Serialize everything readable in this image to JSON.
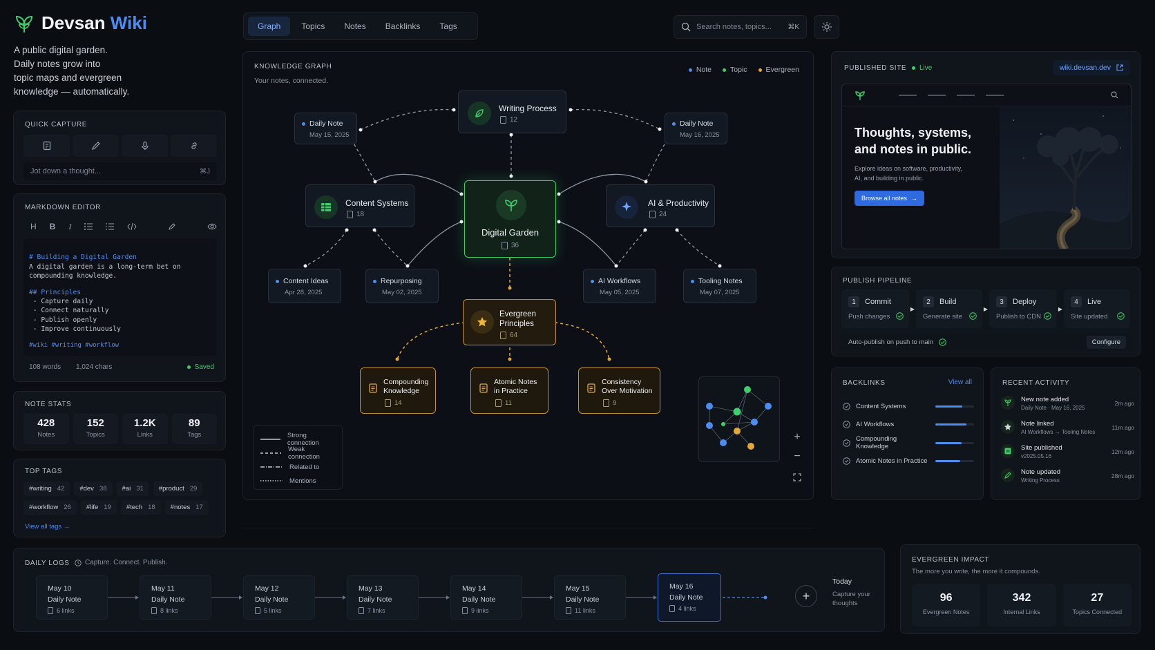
{
  "brand": {
    "name1": "Devsan",
    "name2": "Wiki",
    "tagline": [
      "A public digital garden.",
      "Daily notes grow into",
      "topic maps and evergreen",
      "knowledge — automatically."
    ]
  },
  "nav": {
    "tabs": [
      "Graph",
      "Topics",
      "Notes",
      "Backlinks",
      "Tags"
    ],
    "active": 0
  },
  "search": {
    "placeholder": "Search notes, topics...",
    "shortcut": "⌘K"
  },
  "quick_capture": {
    "title": "QUICK CAPTURE",
    "placeholder": "Jot down a thought...",
    "shortcut": "⌘J",
    "icons": [
      "note-icon",
      "pen-icon",
      "mic-icon",
      "link-icon"
    ]
  },
  "editor": {
    "title": "MARKDOWN EDITOR",
    "toolbar": [
      "H",
      "B",
      "I"
    ],
    "lines": [
      "# Building a Digital Garden",
      "A digital garden is a long-term bet on",
      "compounding knowledge.",
      "",
      "## Principles",
      " - Capture daily",
      " - Connect naturally",
      " - Publish openly",
      " - Improve continuously",
      "",
      "#wiki #writing #workflow"
    ],
    "words": "108 words",
    "chars": "1,024 chars",
    "status": "Saved"
  },
  "stats": {
    "title": "NOTE STATS",
    "items": [
      {
        "value": "428",
        "label": "Notes"
      },
      {
        "value": "152",
        "label": "Topics"
      },
      {
        "value": "1.2K",
        "label": "Links"
      },
      {
        "value": "89",
        "label": "Tags"
      }
    ]
  },
  "tags": {
    "title": "TOP TAGS",
    "items": [
      {
        "name": "#writing",
        "count": "42"
      },
      {
        "name": "#dev",
        "count": "38"
      },
      {
        "name": "#ai",
        "count": "31"
      },
      {
        "name": "#product",
        "count": "29"
      },
      {
        "name": "#workflow",
        "count": "26"
      },
      {
        "name": "#life",
        "count": "19"
      },
      {
        "name": "#tech",
        "count": "18"
      },
      {
        "name": "#notes",
        "count": "17"
      }
    ],
    "view_all": "View all tags"
  },
  "graph": {
    "title": "KNOWLEDGE GRAPH",
    "subtitle": "Your notes, connected.",
    "legend": [
      {
        "label": "Note",
        "color": "#4d8cf0"
      },
      {
        "label": "Topic",
        "color": "#3ecf6a"
      },
      {
        "label": "Evergreen",
        "color": "#e0a83a"
      }
    ],
    "center": {
      "title": "Digital Garden",
      "count": "36"
    },
    "writing": {
      "title": "Writing Process",
      "count": "12"
    },
    "content": {
      "title": "Content Systems",
      "count": "18"
    },
    "ai": {
      "title": "AI & Productivity",
      "count": "24"
    },
    "evergreen": {
      "title1": "Evergreen",
      "title2": "Principles",
      "count": "64"
    },
    "daily_left": {
      "title": "Daily Note",
      "date": "May 15, 2025"
    },
    "daily_right": {
      "title": "Daily Note",
      "date": "May 16, 2025"
    },
    "notes": [
      {
        "title": "Content Ideas",
        "date": "Apr 28, 2025"
      },
      {
        "title": "Repurposing",
        "date": "May 02, 2025"
      },
      {
        "title": "AI Workflows",
        "date": "May 05, 2025"
      },
      {
        "title": "Tooling Notes",
        "date": "May 07, 2025"
      }
    ],
    "ever_children": [
      {
        "t1": "Compounding",
        "t2": "Knowledge",
        "count": "14"
      },
      {
        "t1": "Atomic Notes",
        "t2": "in Practice",
        "count": "11"
      },
      {
        "t1": "Consistency",
        "t2": "Over Motivation",
        "count": "9"
      }
    ],
    "line_legend": [
      "Strong connection",
      "Weak connection",
      "Related to",
      "Mentions"
    ]
  },
  "site": {
    "title": "PUBLISHED SITE",
    "status": "Live",
    "url": "wiki.devsan.dev",
    "headline1": "Thoughts, systems,",
    "headline2": "and notes in public.",
    "desc": [
      "Explore ideas on software, productivity,",
      "AI, and building in public."
    ],
    "cta": "Browse all notes"
  },
  "pipeline": {
    "title": "PUBLISH PIPELINE",
    "steps": [
      {
        "n": "1",
        "name": "Commit",
        "sub": "Push changes"
      },
      {
        "n": "2",
        "name": "Build",
        "sub": "Generate site"
      },
      {
        "n": "3",
        "name": "Deploy",
        "sub": "Publish to CDN"
      },
      {
        "n": "4",
        "name": "Live",
        "sub": "Site updated"
      }
    ],
    "auto": "Auto-publish on push to main",
    "configure": "Configure"
  },
  "backlinks": {
    "title": "BACKLINKS",
    "view_all": "View all",
    "items": [
      {
        "name": "Content Systems",
        "level": 0.7
      },
      {
        "name": "AI Workflows",
        "level": 0.8
      },
      {
        "name": "Compounding Knowledge",
        "level": 0.68
      },
      {
        "name": "Atomic Notes in Practice",
        "level": 0.65
      }
    ]
  },
  "activity": {
    "title": "RECENT ACTIVITY",
    "items": [
      {
        "title": "New note added",
        "sub": "Daily Note · May 16, 2025",
        "time": "2m ago"
      },
      {
        "title": "Note linked",
        "sub": "AI Workflows → Tooling Notes",
        "time": "11m ago"
      },
      {
        "title": "Site published",
        "sub": "v2025.05.16",
        "time": "12m ago"
      },
      {
        "title": "Note updated",
        "sub": "Writing Process",
        "time": "28m ago"
      }
    ]
  },
  "daily": {
    "title": "DAILY LOGS",
    "subtitle": "Capture. Connect. Publish.",
    "items": [
      {
        "date": "May 10",
        "label": "Daily Note",
        "links": "6 links"
      },
      {
        "date": "May 11",
        "label": "Daily Note",
        "links": "8 links"
      },
      {
        "date": "May 12",
        "label": "Daily Note",
        "links": "5 links"
      },
      {
        "date": "May 13",
        "label": "Daily Note",
        "links": "7 links"
      },
      {
        "date": "May 14",
        "label": "Daily Note",
        "links": "9 links"
      },
      {
        "date": "May 15",
        "label": "Daily Note",
        "links": "11 links"
      },
      {
        "date": "May 16",
        "label": "Daily Note",
        "links": "4 links"
      }
    ],
    "today": "Today",
    "today_sub1": "Capture your",
    "today_sub2": "thoughts"
  },
  "impact": {
    "title": "EVERGREEN IMPACT",
    "subtitle": "The more you write, the more it compounds.",
    "items": [
      {
        "value": "96",
        "label": "Evergreen Notes"
      },
      {
        "value": "342",
        "label": "Internal Links"
      },
      {
        "value": "27",
        "label": "Topics Connected"
      }
    ]
  }
}
